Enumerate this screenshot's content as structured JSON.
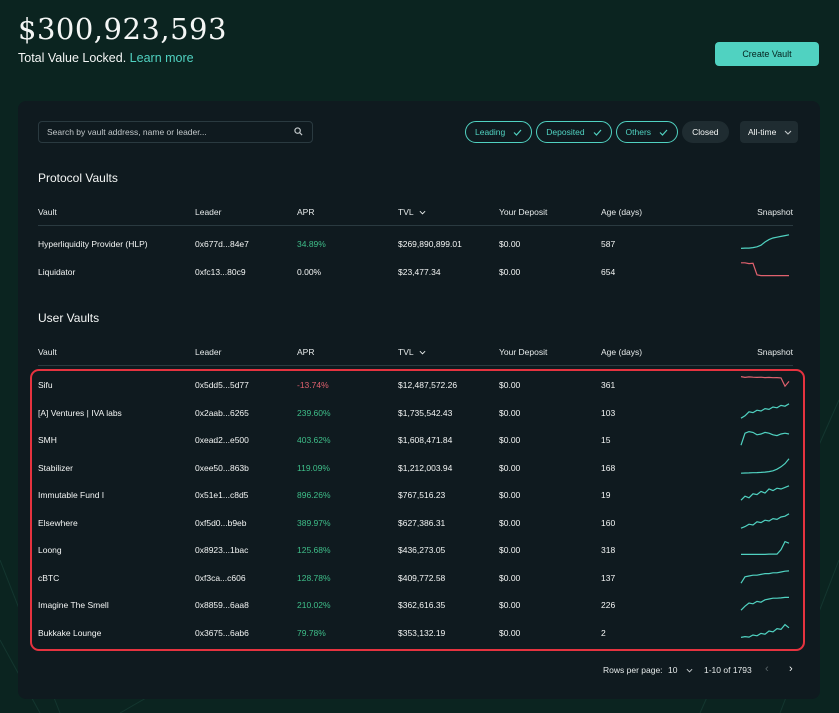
{
  "header": {
    "tvl_amount": "$300,923,593",
    "tvl_caption": "Total Value Locked.",
    "learn_more": "Learn more",
    "create_vault": "Create Vault"
  },
  "search": {
    "placeholder": "Search by vault address, name or leader..."
  },
  "filters": [
    {
      "label": "Leading",
      "checked": true
    },
    {
      "label": "Deposited",
      "checked": true
    },
    {
      "label": "Others",
      "checked": true
    },
    {
      "label": "Closed",
      "checked": false
    }
  ],
  "time_range": "All-time",
  "columns": {
    "vault": "Vault",
    "leader": "Leader",
    "apr": "APR",
    "tvl": "TVL",
    "your_deposit": "Your Deposit",
    "age": "Age (days)",
    "snapshot": "Snapshot"
  },
  "protocol_vaults": {
    "title": "Protocol Vaults",
    "rows": [
      {
        "vault": "Hyperliquidity Provider (HLP)",
        "leader": "0x677d...84e7",
        "apr": "34.89%",
        "apr_sign": "pos",
        "tvl": "$269,890,899.01",
        "deposit": "$0.00",
        "age": "587",
        "snapshot": [
          0.1,
          0.12,
          0.12,
          0.15,
          0.2,
          0.3,
          0.5,
          0.65,
          0.75,
          0.8,
          0.85,
          0.9,
          0.95
        ],
        "trend": "up"
      },
      {
        "vault": "Liquidator",
        "leader": "0xfc13...80c9",
        "apr": "0.00%",
        "apr_sign": "neutral",
        "tvl": "$23,477.34",
        "deposit": "$0.00",
        "age": "654",
        "snapshot": [
          0.95,
          0.95,
          0.9,
          0.92,
          0.2,
          0.15,
          0.15,
          0.15,
          0.15,
          0.15,
          0.15,
          0.15,
          0.15
        ],
        "trend": "down"
      }
    ]
  },
  "user_vaults": {
    "title": "User Vaults",
    "rows": [
      {
        "vault": "Sifu",
        "leader": "0x5dd5...5d77",
        "apr": "-13.74%",
        "apr_sign": "neg",
        "tvl": "$12,487,572.26",
        "deposit": "$0.00",
        "age": "361",
        "snapshot": [
          0.9,
          0.85,
          0.88,
          0.86,
          0.85,
          0.86,
          0.84,
          0.85,
          0.83,
          0.84,
          0.82,
          0.3,
          0.6
        ],
        "trend": "down"
      },
      {
        "vault": "[A] Ventures | IVA labs",
        "leader": "0x2aab...6265",
        "apr": "239.60%",
        "apr_sign": "pos",
        "tvl": "$1,735,542.43",
        "deposit": "$0.00",
        "age": "103",
        "snapshot": [
          0.05,
          0.2,
          0.45,
          0.4,
          0.55,
          0.5,
          0.65,
          0.6,
          0.75,
          0.7,
          0.85,
          0.8,
          0.95
        ],
        "trend": "up"
      },
      {
        "vault": "SMH",
        "leader": "0xead2...e500",
        "apr": "403.62%",
        "apr_sign": "pos",
        "tvl": "$1,608,471.84",
        "deposit": "$0.00",
        "age": "15",
        "snapshot": [
          0.05,
          0.8,
          0.9,
          0.85,
          0.7,
          0.75,
          0.85,
          0.8,
          0.7,
          0.65,
          0.75,
          0.8,
          0.75
        ],
        "trend": "up"
      },
      {
        "vault": "Stabilizer",
        "leader": "0xee50...863b",
        "apr": "119.09%",
        "apr_sign": "pos",
        "tvl": "$1,212,003.94",
        "deposit": "$0.00",
        "age": "168",
        "snapshot": [
          0.05,
          0.06,
          0.07,
          0.08,
          0.09,
          0.1,
          0.12,
          0.15,
          0.2,
          0.3,
          0.45,
          0.65,
          0.95
        ],
        "trend": "up"
      },
      {
        "vault": "Immutable Fund I",
        "leader": "0x51e1...c8d5",
        "apr": "896.26%",
        "apr_sign": "pos",
        "tvl": "$767,516.23",
        "deposit": "$0.00",
        "age": "19",
        "snapshot": [
          0.05,
          0.3,
          0.2,
          0.45,
          0.4,
          0.6,
          0.5,
          0.75,
          0.65,
          0.8,
          0.75,
          0.85,
          0.95
        ],
        "trend": "up"
      },
      {
        "vault": "Elsewhere",
        "leader": "0xf5d0...b9eb",
        "apr": "389.97%",
        "apr_sign": "pos",
        "tvl": "$627,386.31",
        "deposit": "$0.00",
        "age": "160",
        "snapshot": [
          0.05,
          0.15,
          0.3,
          0.25,
          0.45,
          0.4,
          0.55,
          0.5,
          0.65,
          0.6,
          0.75,
          0.8,
          0.95
        ],
        "trend": "up"
      },
      {
        "vault": "Loong",
        "leader": "0x8923...1bac",
        "apr": "125.68%",
        "apr_sign": "pos",
        "tvl": "$436,273.05",
        "deposit": "$0.00",
        "age": "318",
        "snapshot": [
          0.1,
          0.1,
          0.1,
          0.1,
          0.1,
          0.1,
          0.1,
          0.12,
          0.12,
          0.12,
          0.4,
          0.9,
          0.8
        ],
        "trend": "up"
      },
      {
        "vault": "cBTC",
        "leader": "0xf3ca...c606",
        "apr": "128.78%",
        "apr_sign": "pos",
        "tvl": "$409,772.58",
        "deposit": "$0.00",
        "age": "137",
        "snapshot": [
          0.05,
          0.45,
          0.5,
          0.55,
          0.55,
          0.6,
          0.65,
          0.65,
          0.7,
          0.7,
          0.75,
          0.8,
          0.82
        ],
        "trend": "up"
      },
      {
        "vault": "Imagine The Smell",
        "leader": "0x8859...6aa8",
        "apr": "210.02%",
        "apr_sign": "pos",
        "tvl": "$362,616.35",
        "deposit": "$0.00",
        "age": "226",
        "snapshot": [
          0.05,
          0.3,
          0.5,
          0.45,
          0.6,
          0.55,
          0.7,
          0.75,
          0.8,
          0.8,
          0.82,
          0.85,
          0.85
        ],
        "trend": "up"
      },
      {
        "vault": "Bukkake Lounge",
        "leader": "0x3675...6ab6",
        "apr": "79.78%",
        "apr_sign": "pos",
        "tvl": "$353,132.19",
        "deposit": "$0.00",
        "age": "2",
        "snapshot": [
          0.1,
          0.15,
          0.12,
          0.25,
          0.2,
          0.35,
          0.3,
          0.5,
          0.45,
          0.65,
          0.6,
          0.9,
          0.7
        ],
        "trend": "up"
      }
    ]
  },
  "pagination": {
    "rows_per_page_label": "Rows per page:",
    "rows_per_page": "10",
    "range": "1-10 of 1793"
  },
  "colors": {
    "accent": "#50d2c1",
    "positive": "#3fbf8a",
    "negative": "#e0616e",
    "highlight": "#e5333f"
  }
}
